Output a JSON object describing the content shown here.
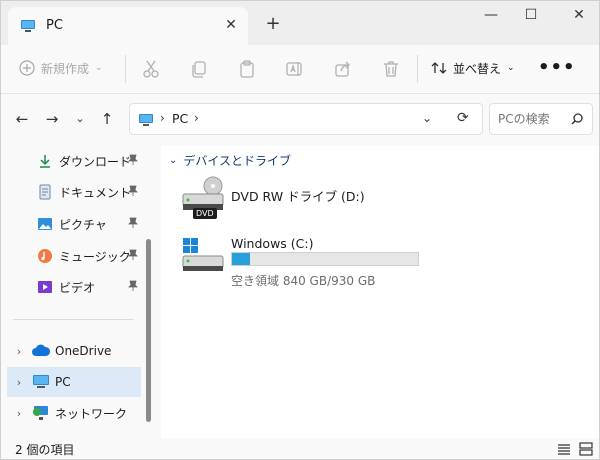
{
  "window": {
    "tab_title": "PC",
    "close_tab": "✕",
    "new_tab": "+",
    "controls": {
      "minimize": "—",
      "maximize": "☐",
      "close": "✕"
    }
  },
  "toolbar": {
    "new_label": "新規作成",
    "sort_label": "並べ替え",
    "more_label": "•••",
    "icons": [
      "cut-icon",
      "copy-icon",
      "paste-icon",
      "rename-icon",
      "share-icon",
      "delete-icon"
    ]
  },
  "address": {
    "location": "PC",
    "search_placeholder": "PCの検索"
  },
  "sidebar": {
    "quick_access": [
      {
        "label": "ダウンロード",
        "icon": "download-icon"
      },
      {
        "label": "ドキュメント",
        "icon": "document-icon"
      },
      {
        "label": "ピクチャ",
        "icon": "pictures-icon"
      },
      {
        "label": "ミュージック",
        "icon": "music-icon"
      },
      {
        "label": "ビデオ",
        "icon": "video-icon"
      }
    ],
    "tree": [
      {
        "label": "OneDrive",
        "icon": "cloud-icon"
      },
      {
        "label": "PC",
        "icon": "pc-icon",
        "selected": true
      },
      {
        "label": "ネットワーク",
        "icon": "network-icon"
      }
    ]
  },
  "content": {
    "group_title": "デバイスとドライブ",
    "drives": [
      {
        "name": "DVD RW ドライブ (D:)",
        "badge": "DVD"
      },
      {
        "name": "Windows (C:)",
        "free_text": "空き領域 840 GB/930 GB",
        "used_fraction": 0.097
      }
    ]
  },
  "status": {
    "item_count": "2 個の項目"
  },
  "colors": {
    "accent": "#26a0da",
    "selected_bg": "#dceaf8"
  }
}
